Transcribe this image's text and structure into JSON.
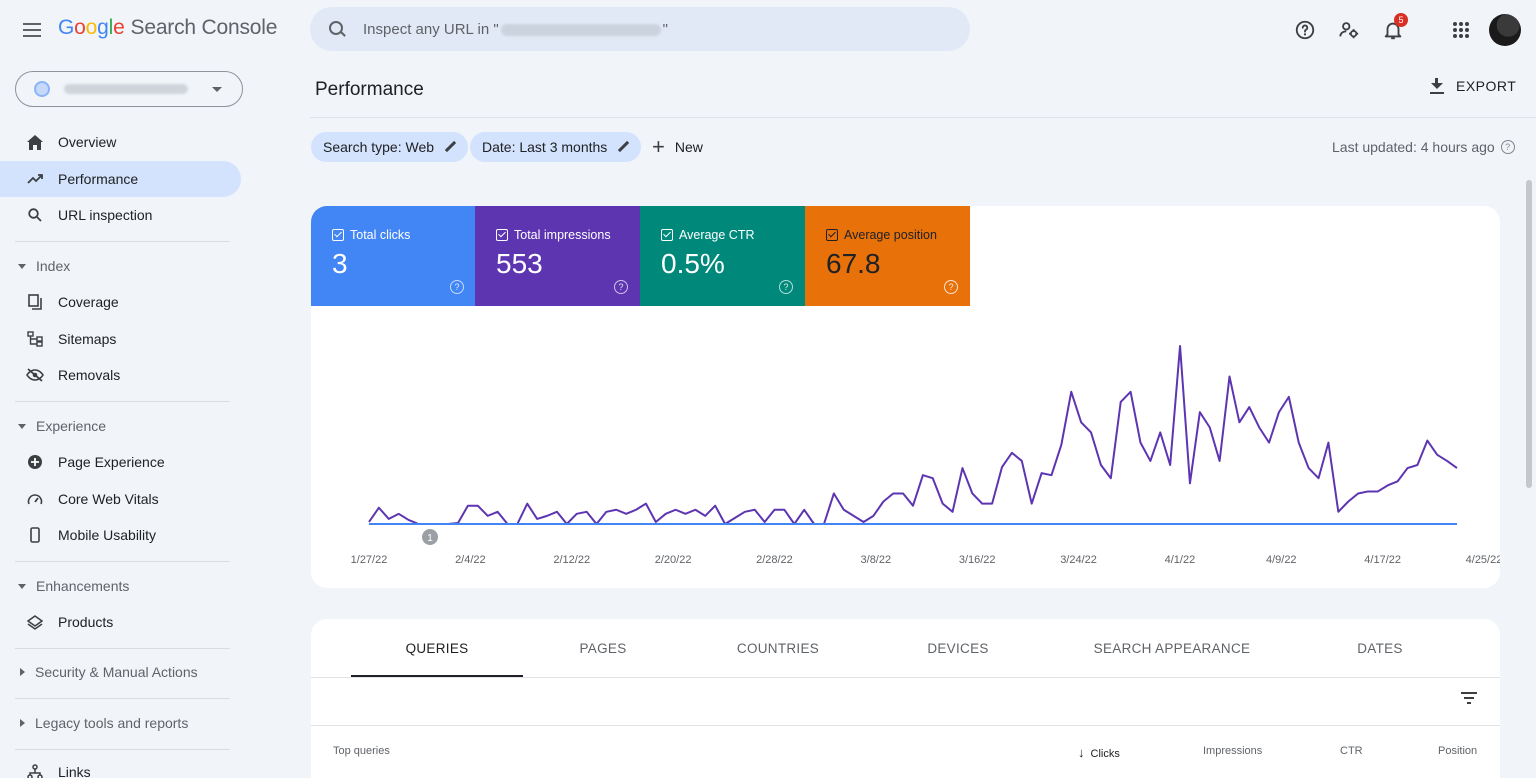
{
  "app": {
    "logo_google": [
      "G",
      "o",
      "o",
      "g",
      "l",
      "e"
    ],
    "logo_colors": [
      "#4285F4",
      "#EA4335",
      "#FBBC05",
      "#4285F4",
      "#34A853",
      "#EA4335"
    ],
    "logo_product": "Search Console",
    "search_prefix": "Inspect any URL in \"",
    "search_suffix": "\"",
    "notifications_count": "5"
  },
  "sidebar": {
    "items": {
      "overview": "Overview",
      "performance": "Performance",
      "url_inspection": "URL inspection",
      "index": "Index",
      "coverage": "Coverage",
      "sitemaps": "Sitemaps",
      "removals": "Removals",
      "experience": "Experience",
      "page_experience": "Page Experience",
      "core_web_vitals": "Core Web Vitals",
      "mobile_usability": "Mobile Usability",
      "enhancements": "Enhancements",
      "products": "Products",
      "security": "Security & Manual Actions",
      "legacy": "Legacy tools and reports",
      "links": "Links"
    }
  },
  "main": {
    "title": "Performance",
    "export_label": "EXPORT",
    "chips": {
      "search_type": "Search type: Web",
      "date": "Date: Last 3 months"
    },
    "new_label": "New",
    "last_updated": "Last updated: 4 hours ago"
  },
  "metrics": [
    {
      "label": "Total clicks",
      "value": "3",
      "color": "#4285f4"
    },
    {
      "label": "Total impressions",
      "value": "553",
      "color": "#5e35b1"
    },
    {
      "label": "Average CTR",
      "value": "0.5%",
      "color": "#00897b"
    },
    {
      "label": "Average position",
      "value": "67.8",
      "color": "#e8710a"
    }
  ],
  "chart_data": {
    "type": "line",
    "x": [
      "1/27/22",
      "2/4/22",
      "2/12/22",
      "2/20/22",
      "2/28/22",
      "3/8/22",
      "3/16/22",
      "3/24/22",
      "4/1/22",
      "4/9/22",
      "4/17/22",
      "4/25/22"
    ],
    "annotation": "1",
    "series": [
      {
        "name": "Total impressions",
        "color": "#5e35b1",
        "values": [
          2,
          16,
          5,
          10,
          4,
          0,
          0,
          0,
          0,
          1,
          18,
          18,
          8,
          12,
          0,
          0,
          20,
          5,
          8,
          12,
          0,
          10,
          12,
          0,
          12,
          14,
          10,
          14,
          20,
          2,
          10,
          14,
          10,
          14,
          8,
          18,
          0,
          6,
          12,
          14,
          2,
          14,
          14,
          0,
          14,
          0,
          0,
          30,
          14,
          8,
          2,
          8,
          22,
          30,
          30,
          18,
          48,
          45,
          20,
          12,
          55,
          30,
          20,
          20,
          56,
          70,
          62,
          20,
          50,
          48,
          78,
          130,
          100,
          90,
          58,
          45,
          120,
          130,
          80,
          62,
          90,
          58,
          175,
          40,
          110,
          95,
          62,
          145,
          100,
          115,
          95,
          80,
          110,
          125,
          80,
          55,
          45,
          80,
          12,
          22,
          30,
          32,
          32,
          38,
          42,
          55,
          58,
          82,
          68,
          62,
          55
        ]
      },
      {
        "name": "Average position",
        "color": "#e8710a",
        "values": []
      }
    ]
  },
  "table": {
    "tabs": [
      "QUERIES",
      "PAGES",
      "COUNTRIES",
      "DEVICES",
      "SEARCH APPEARANCE",
      "DATES"
    ],
    "columns": {
      "top_queries": "Top queries",
      "clicks": "Clicks",
      "impressions": "Impressions",
      "ctr": "CTR",
      "position": "Position"
    }
  }
}
